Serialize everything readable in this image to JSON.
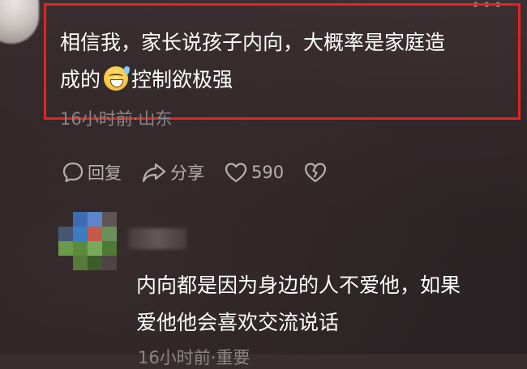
{
  "comment": {
    "text_line1": "相信我，家长说孩子内向，大概率是家庭造",
    "text_line2_before": "成的",
    "text_line2_after": "控制欲极强",
    "meta": "16小时前·山东"
  },
  "actions": {
    "reply_label": "回复",
    "share_label": "分享",
    "like_count": "590"
  },
  "reply": {
    "text_line1": "内向都是因为身边的人不爱他，如果",
    "text_line2": "爱他他会喜欢交流说话",
    "meta": "16小时前·重要"
  },
  "colors": {
    "highlight_border": "#e42323",
    "text_primary": "#ffffff",
    "text_secondary": "#8c8585",
    "icon_color": "#b7b0b0"
  },
  "icons": [
    "comment-bubble-icon",
    "share-arrow-icon",
    "heart-icon",
    "broken-heart-icon",
    "grin-sweat-emoji-icon",
    "more-dots-icon"
  ]
}
